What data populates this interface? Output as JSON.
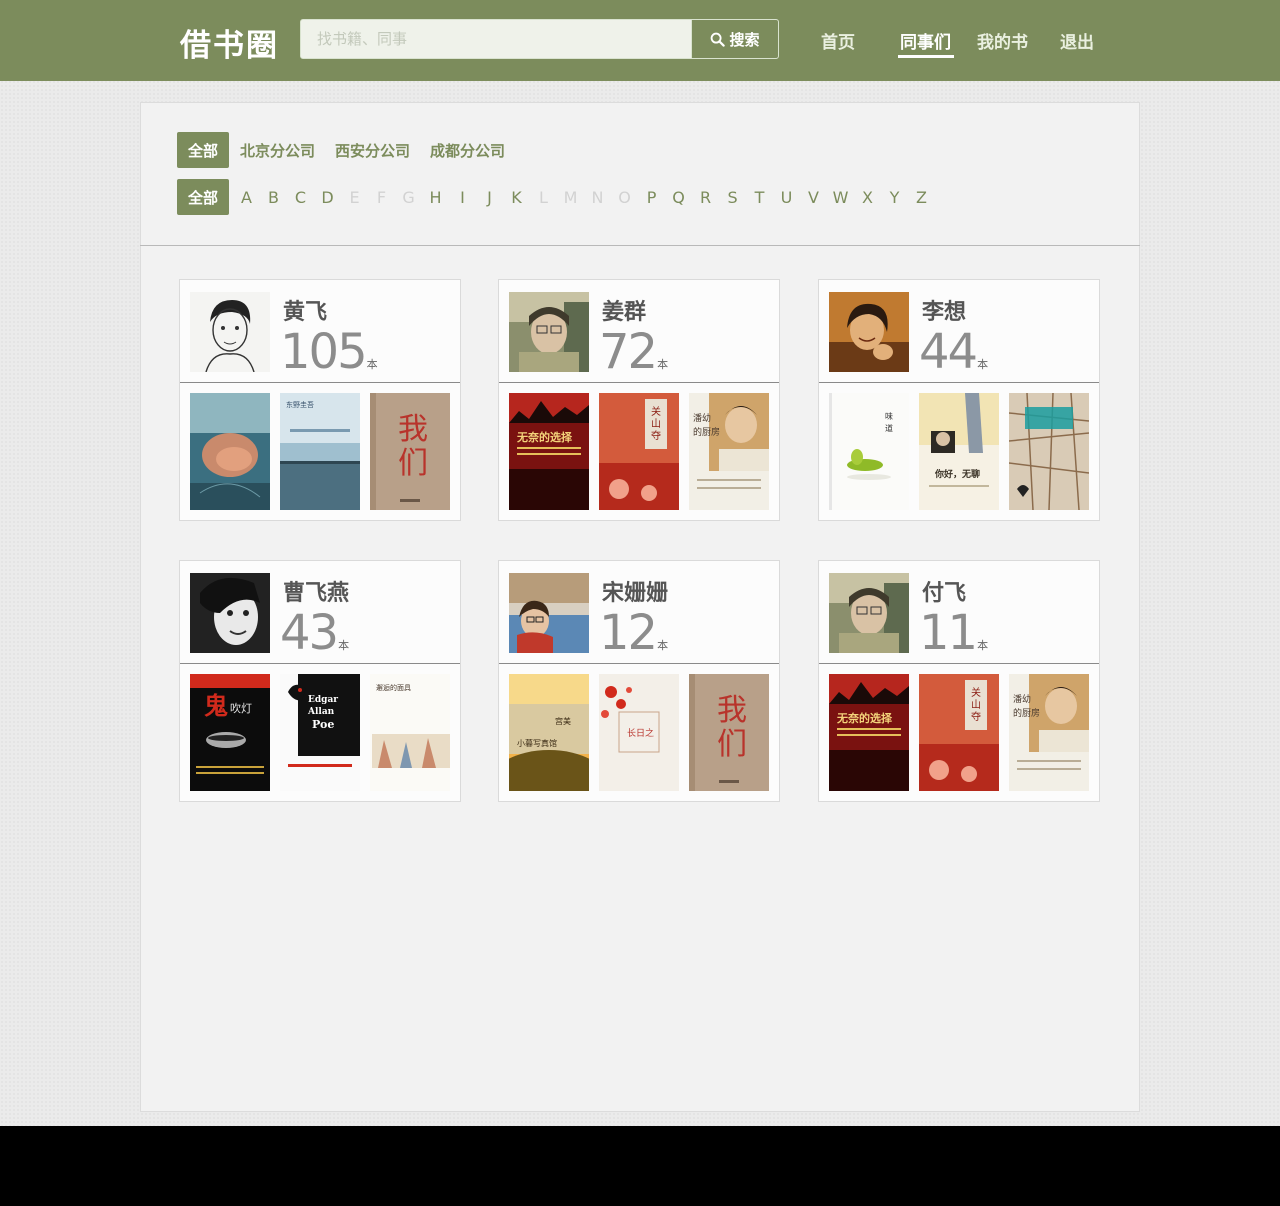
{
  "header": {
    "logo": "借书圈",
    "search_placeholder": "找书籍、同事",
    "search_button": "搜索",
    "nav": [
      {
        "label": "首页"
      },
      {
        "label": "同事们",
        "active": true
      },
      {
        "label": "我的书"
      },
      {
        "label": "退出"
      }
    ]
  },
  "filters": {
    "all_label": "全部",
    "companies": [
      "北京分公司",
      "西安分公司",
      "成都分公司"
    ],
    "letters": [
      {
        "l": "A",
        "enabled": true
      },
      {
        "l": "B",
        "enabled": true
      },
      {
        "l": "C",
        "enabled": true
      },
      {
        "l": "D",
        "enabled": true
      },
      {
        "l": "E",
        "enabled": false
      },
      {
        "l": "F",
        "enabled": false
      },
      {
        "l": "G",
        "enabled": false
      },
      {
        "l": "H",
        "enabled": true
      },
      {
        "l": "I",
        "enabled": true
      },
      {
        "l": "J",
        "enabled": true
      },
      {
        "l": "K",
        "enabled": true
      },
      {
        "l": "L",
        "enabled": false
      },
      {
        "l": "M",
        "enabled": false
      },
      {
        "l": "N",
        "enabled": false
      },
      {
        "l": "O",
        "enabled": false
      },
      {
        "l": "P",
        "enabled": true
      },
      {
        "l": "Q",
        "enabled": true
      },
      {
        "l": "R",
        "enabled": true
      },
      {
        "l": "S",
        "enabled": true
      },
      {
        "l": "T",
        "enabled": true
      },
      {
        "l": "U",
        "enabled": true
      },
      {
        "l": "V",
        "enabled": true
      },
      {
        "l": "W",
        "enabled": true
      },
      {
        "l": "X",
        "enabled": true
      },
      {
        "l": "Y",
        "enabled": true
      },
      {
        "l": "Z",
        "enabled": true
      }
    ]
  },
  "colleagues": [
    {
      "name": "黄飞",
      "count": "105",
      "unit": "本",
      "avatar": "sketch-portrait",
      "books": [
        {
          "style": "photo-blue",
          "text": ""
        },
        {
          "style": "sea",
          "text": "东野圭吾"
        },
        {
          "style": "tan-red",
          "text": "我们"
        }
      ]
    },
    {
      "name": "姜群",
      "count": "72",
      "unit": "本",
      "avatar": "photo-girl-glasses",
      "books": [
        {
          "style": "red-black",
          "text": "无奈的选择"
        },
        {
          "style": "red-white",
          "text": "关山夺路"
        },
        {
          "style": "kitchen",
          "text": "潘幼的厨房"
        }
      ]
    },
    {
      "name": "李想",
      "count": "44",
      "unit": "本",
      "avatar": "photo-girl-smile",
      "books": [
        {
          "style": "white-green",
          "text": "味道"
        },
        {
          "style": "cream-photo",
          "text": "你好，无聊"
        },
        {
          "style": "map",
          "text": ""
        }
      ]
    },
    {
      "name": "曹飞燕",
      "count": "43",
      "unit": "本",
      "avatar": "photo-bw-face",
      "books": [
        {
          "style": "black-red",
          "text": "鬼吹灯"
        },
        {
          "style": "poe",
          "text": "Edgar Allan Poe"
        },
        {
          "style": "painting",
          "text": "邂逅的面具"
        }
      ]
    },
    {
      "name": "宋姗姗",
      "count": "12",
      "unit": "本",
      "avatar": "photo-girl-scarf",
      "books": [
        {
          "style": "landscape",
          "text": "宫美部雪 小幕写真馆"
        },
        {
          "style": "red-flowers",
          "text": "长日之"
        },
        {
          "style": "tan-red",
          "text": "我们"
        }
      ]
    },
    {
      "name": "付飞",
      "count": "11",
      "unit": "本",
      "avatar": "photo-girl-glasses",
      "books": [
        {
          "style": "red-black",
          "text": "无奈的选择"
        },
        {
          "style": "red-white",
          "text": "关山夺路"
        },
        {
          "style": "kitchen",
          "text": "潘幼的厨房"
        }
      ]
    }
  ]
}
